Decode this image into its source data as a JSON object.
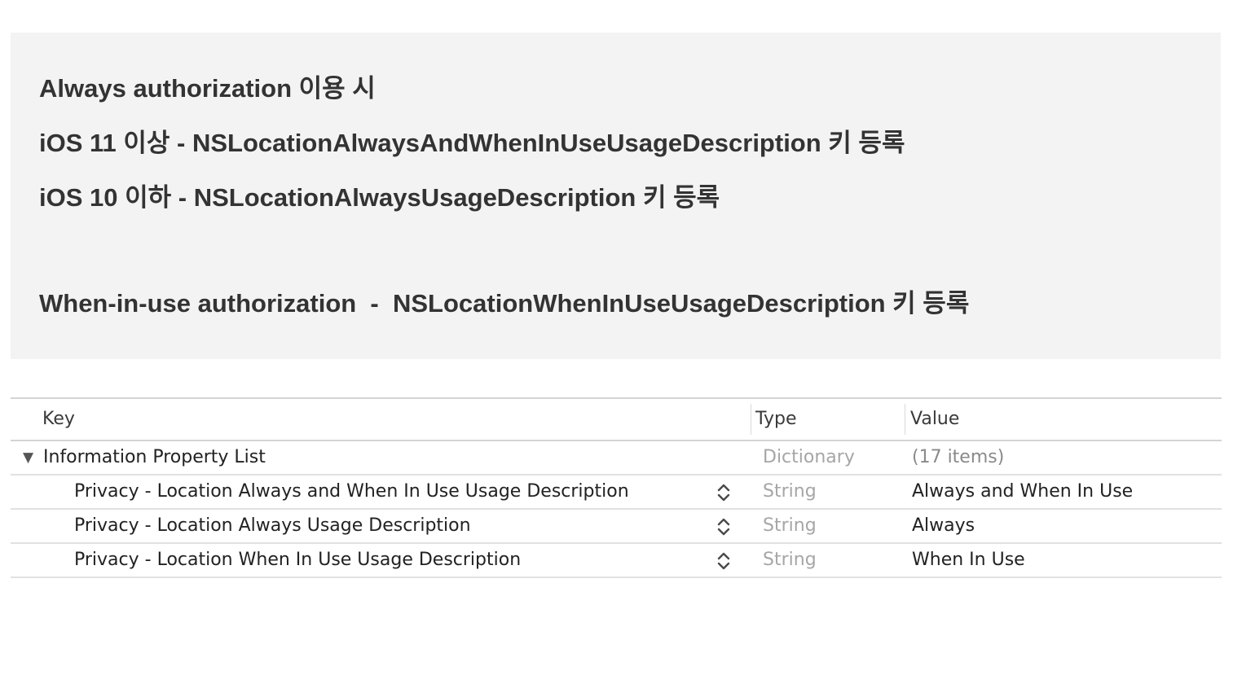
{
  "notes": {
    "line1": "Always authorization 이용 시",
    "line2": "iOS 11 이상 - NSLocationAlwaysAndWhenInUseUsageDescription 키 등록",
    "line3": "iOS 10 이하 - NSLocationAlwaysUsageDescription 키 등록",
    "line4": "When-in-use authorization  -  NSLocationWhenInUseUsageDescription 키 등록"
  },
  "plist": {
    "columns": {
      "key": "Key",
      "type": "Type",
      "value": "Value"
    },
    "root": {
      "disclosure_icon": "triangle-down",
      "key": "Information Property List",
      "type": "Dictionary",
      "value": "(17 items)"
    },
    "rows": [
      {
        "key": "Privacy - Location Always and When In Use Usage Description",
        "type": "String",
        "value": "Always and When In Use"
      },
      {
        "key": "Privacy - Location Always Usage Description",
        "type": "String",
        "value": "Always"
      },
      {
        "key": "Privacy - Location When In Use Usage Description",
        "type": "String",
        "value": "When In Use"
      }
    ]
  },
  "colors": {
    "note_background": "#f3f3f3",
    "note_text": "#333333",
    "grid_line": "#d4d4d4",
    "muted_text": "#a6a6a6"
  }
}
